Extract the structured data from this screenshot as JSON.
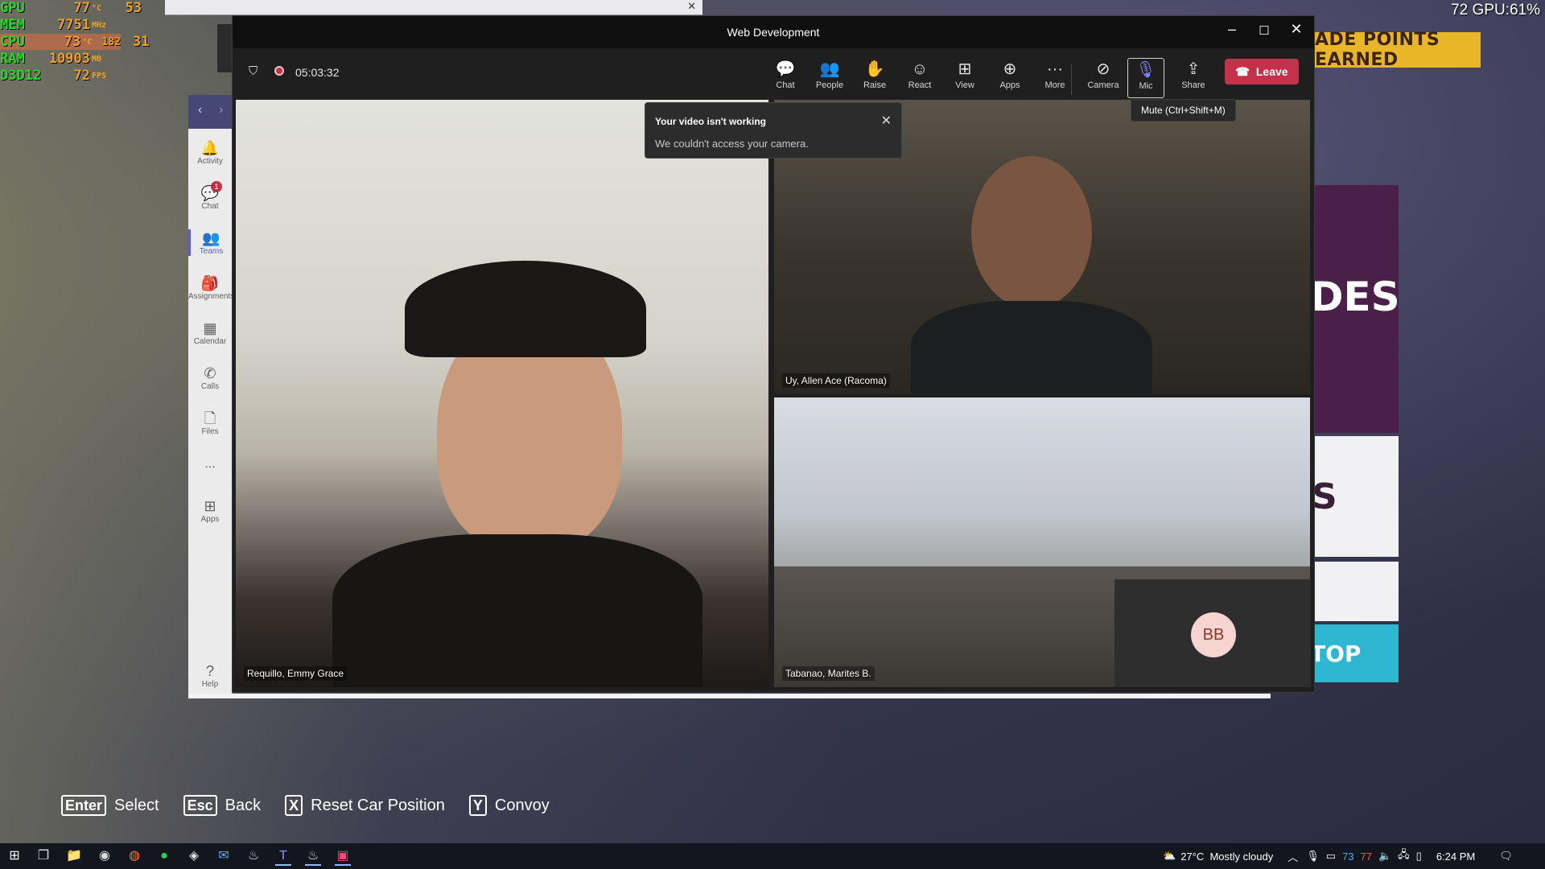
{
  "overlay": {
    "rows": [
      {
        "label": "GPU",
        "value": "77",
        "unit": "°C"
      },
      {
        "label": "MEM",
        "value": "7751",
        "unit": "MHz"
      },
      {
        "label": "CPU",
        "value": "73",
        "unit": "°C"
      },
      {
        "label": "RAM",
        "value": "10903",
        "unit": "MB"
      },
      {
        "label": "D3D12",
        "value": "72",
        "unit": "FPS"
      }
    ],
    "extra_1": "53",
    "extra_2": "182",
    "extra_3": "31",
    "top_right": "72 GPU:61%"
  },
  "game": {
    "banner": "ADE POINTS EARNED",
    "side_text_1": "DES",
    "side_text_2": "S",
    "side_cta": "TOP",
    "hints": [
      {
        "key": "Enter",
        "label": "Select"
      },
      {
        "key": "Esc",
        "label": "Back"
      },
      {
        "key": "X",
        "label": "Reset Car Position"
      },
      {
        "key": "Y",
        "label": "Convoy"
      }
    ]
  },
  "teams_rail": {
    "items": [
      {
        "label": "Activity",
        "icon": "bell-icon"
      },
      {
        "label": "Chat",
        "icon": "chat-icon",
        "badge": "1"
      },
      {
        "label": "Teams",
        "icon": "teams-icon",
        "active": true
      },
      {
        "label": "Assignments",
        "icon": "assignment-icon"
      },
      {
        "label": "Calendar",
        "icon": "calendar-icon"
      },
      {
        "label": "Calls",
        "icon": "phone-icon"
      },
      {
        "label": "Files",
        "icon": "file-icon"
      },
      {
        "label": "...",
        "icon": "more-icon"
      },
      {
        "label": "Apps",
        "icon": "apps-icon"
      },
      {
        "label": "Help",
        "icon": "help-icon"
      }
    ]
  },
  "meeting": {
    "title": "Web Development",
    "timer": "05:03:32",
    "toolbar": [
      {
        "label": "Chat",
        "icon": "chat-icon"
      },
      {
        "label": "People",
        "icon": "people-icon"
      },
      {
        "label": "Raise",
        "icon": "hand-icon"
      },
      {
        "label": "React",
        "icon": "smile-icon"
      },
      {
        "label": "View",
        "icon": "grid-icon"
      },
      {
        "label": "Apps",
        "icon": "plus-box-icon"
      },
      {
        "label": "More",
        "icon": "ellipsis-icon"
      },
      {
        "label": "Camera",
        "icon": "camera-off-icon"
      },
      {
        "label": "Mic",
        "icon": "mic-icon"
      },
      {
        "label": "Share",
        "icon": "share-icon"
      }
    ],
    "leave_label": "Leave",
    "tooltip": "Mute (Ctrl+Shift+M)",
    "toast": {
      "title": "Your video isn't working",
      "body": "We couldn't access your camera."
    },
    "participants": [
      {
        "name": "Requillo, Emmy Grace"
      },
      {
        "name": "Uy, Allen Ace (Racoma)"
      },
      {
        "name": "Tabanao, Marites B."
      },
      {
        "initials": "BB"
      }
    ]
  },
  "taskbar": {
    "weather": "27°C  Mostly cloudy",
    "temp_1": "73",
    "temp_2": "77",
    "time": "6:24 PM"
  }
}
